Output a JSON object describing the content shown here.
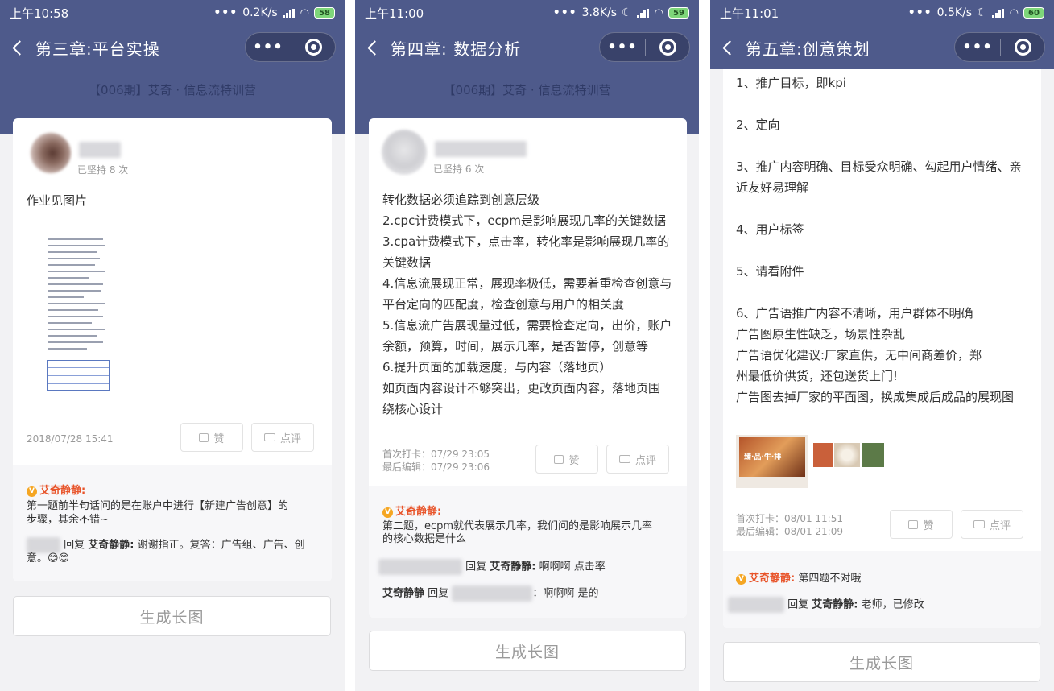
{
  "screens": [
    {
      "status": {
        "time": "上午10:58",
        "speed": "0.2K/s",
        "battery": "58"
      },
      "title": "第三章:平台实操",
      "banner": "【006期】艾奇 · 信息流特训营",
      "post": {
        "streak": "已坚持 8 次",
        "text": "作业见图片",
        "date": "2018/07/28 15:41",
        "like": "赞",
        "comment": "点评"
      },
      "comments": {
        "c1_author": "艾奇静静:",
        "c1_text_1": "第一题前半句话问的是在账户中进行【新建广告创意】的",
        "c1_text_2": "步骤，其余不错~",
        "c2_reply": "回复",
        "c2_author": "艾奇静静:",
        "c2_text_1": "谢谢指正。复答：广告组、广告、创",
        "c2_text_2": "意。😊😊"
      },
      "gen": "生成长图"
    },
    {
      "status": {
        "time": "上午11:00",
        "speed": "3.8K/s",
        "battery": "59"
      },
      "title": "第四章: 数据分析",
      "banner": "【006期】艾奇 · 信息流特训营",
      "post": {
        "streak": "已坚持 6 次",
        "lines": [
          "转化数据必须追踪到创意层级",
          "2.cpc计费模式下，ecpm是影响展现几率的关键数据",
          "3.cpa计费模式下，点击率，转化率是影响展现几率的",
          "关键数据",
          "4.信息流展现正常，展现率极低，需要着重检查创意与",
          "平台定向的匹配度，检查创意与用户的相关度",
          "5.信息流广告展现量过低，需要检查定向，出价，账户",
          "余额，预算，时间，展示几率，是否暂停，创意等",
          "6.提升页面的加载速度，与内容（落地页）",
          "如页面内容设计不够突出，更改页面内容，落地页围",
          "绕核心设计"
        ],
        "date1": "首次打卡：07/29 23:05",
        "date2": "最后编辑：07/29 23:06",
        "like": "赞",
        "comment": "点评"
      },
      "comments": {
        "c1_author": "艾奇静静:",
        "c1_text_1": "第二题，ecpm就代表展示几率，我们问的是影响展示几率",
        "c1_text_2": "的核心数据是什么",
        "c2_reply": "回复",
        "c2_author": "艾奇静静:",
        "c2_text": "啊啊啊 点击率",
        "c3_author": "艾奇静静",
        "c3_reply": "回复",
        "c3_text": "：啊啊啊 是的"
      },
      "gen": "生成长图"
    },
    {
      "status": {
        "time": "上午11:01",
        "speed": "0.5K/s",
        "battery": "60"
      },
      "title": "第五章:创意策划",
      "post": {
        "lines": [
          "1、推广目标，即kpi",
          "",
          "2、定向",
          "",
          "3、推广内容明确、目标受众明确、勾起用户情绪、亲",
          "近友好易理解",
          "",
          "4、用户标签",
          "",
          "5、请看附件",
          "",
          "6、广告语推广内容不清晰，用户群体不明确",
          "广告图原生性缺乏，场景性杂乱",
          "广告语优化建议:厂家直供，无中间商差价，郑",
          "州最低价供货，还包送货上门!",
          "广告图去掉厂家的平面图，换成集成后成品的展现图"
        ],
        "ad1_caption": "臻·品·牛·排",
        "date1": "首次打卡：08/01 11:51",
        "date2": "最后编辑：08/01 21:09",
        "like": "赞",
        "comment": "点评"
      },
      "comments": {
        "c1_author": "艾奇静静:",
        "c1_text": "第四题不对哦",
        "c2_reply": "回复",
        "c2_author": "艾奇静静:",
        "c2_text": "老师，已修改"
      },
      "gen": "生成长图"
    }
  ]
}
